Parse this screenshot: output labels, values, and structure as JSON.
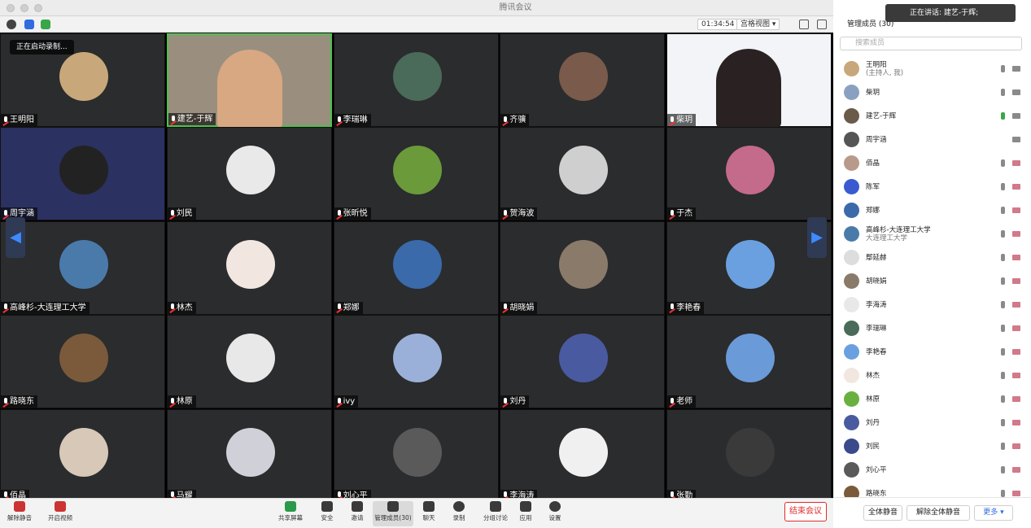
{
  "window": {
    "title": "腾讯会议"
  },
  "top": {
    "timer": "01:34:54",
    "view": "宫格视图 ▾",
    "recording": "正在启动录制..."
  },
  "tiles": [
    {
      "name": "王明阳",
      "bg": "#2b2c2e",
      "av": "#c8a87a"
    },
    {
      "name": "建艺-于辉",
      "bg": "#9a8f7e",
      "av": "",
      "video": true
    },
    {
      "name": "李瑞琳",
      "bg": "#2b2c2e",
      "av": "#4a6a5a"
    },
    {
      "name": "齐骥",
      "bg": "#2b2c2e",
      "av": "#7a5a4a"
    },
    {
      "name": "柴玥",
      "bg": "#f2f4f7",
      "av": "",
      "video": true
    },
    {
      "name": "周宇涵",
      "bg": "#2b3160",
      "av": "#222"
    },
    {
      "name": "刘民",
      "bg": "#2b2c2e",
      "av": "#e9e9e9"
    },
    {
      "name": "张昕悦",
      "bg": "#2b2c2e",
      "av": "#6a9a3a"
    },
    {
      "name": "贺海波",
      "bg": "#2b2c2e",
      "av": "#cfcfcf"
    },
    {
      "name": "于杰",
      "bg": "#2b2c2e",
      "av": "#c46a8a"
    },
    {
      "name": "高峰杉-大连理工大学",
      "bg": "#2b2c2e",
      "av": "#4a7aaa"
    },
    {
      "name": "林杰",
      "bg": "#2b2c2e",
      "av": "#f1e6e0"
    },
    {
      "name": "郑娜",
      "bg": "#2b2c2e",
      "av": "#3a6aaa"
    },
    {
      "name": "胡晓娟",
      "bg": "#2b2c2e",
      "av": "#8a7a6a"
    },
    {
      "name": "李艳春",
      "bg": "#2b2c2e",
      "av": "#6aa0e0"
    },
    {
      "name": "路晓东",
      "bg": "#2b2c2e",
      "av": "#7a5a3a"
    },
    {
      "name": "林原",
      "bg": "#2b2c2e",
      "av": "#e8e8e8"
    },
    {
      "name": "ivy",
      "bg": "#2b2c2e",
      "av": "#9ab0d8"
    },
    {
      "name": "刘丹",
      "bg": "#2b2c2e",
      "av": "#4a5aa0"
    },
    {
      "name": "老师",
      "bg": "#2b2c2e",
      "av": "#6a9ad8"
    },
    {
      "name": "佰晶",
      "bg": "#2b2c2e",
      "av": "#d8c8b8"
    },
    {
      "name": "马耀",
      "bg": "#2b2c2e",
      "av": "#d0d0d8"
    },
    {
      "name": "刘心平",
      "bg": "#2b2c2e",
      "av": "#5a5a5a"
    },
    {
      "name": "李海涛",
      "bg": "#2b2c2e",
      "av": "#f0f0f0"
    },
    {
      "name": "张勤",
      "bg": "#2b2c2e",
      "av": "#3a3a3a"
    }
  ],
  "panel": {
    "title": "管理成员 (30)",
    "speaking": "正在讲话: 建艺-于辉;",
    "search_placeholder": "搜索成员",
    "members": [
      {
        "name": "王明阳",
        "sub": "(主持人, 我)",
        "color": "#c8a87a"
      },
      {
        "name": "柴玥",
        "sub": "",
        "color": "#8aa0c0"
      },
      {
        "name": "建艺-于辉",
        "sub": "",
        "color": "#6a5a4a"
      },
      {
        "name": "周宇涵",
        "sub": "",
        "color": "#555"
      },
      {
        "name": "佰晶",
        "sub": "",
        "color": "#b89a8a"
      },
      {
        "name": "陈军",
        "sub": "",
        "color": "#3a5ad0"
      },
      {
        "name": "郑娜",
        "sub": "",
        "color": "#3a6aaa"
      },
      {
        "name": "高峰杉-大连理工大学",
        "sub": "大连理工大学",
        "color": "#4a7aaa"
      },
      {
        "name": "鄢延赫",
        "sub": "",
        "color": "#ddd"
      },
      {
        "name": "胡晓娟",
        "sub": "",
        "color": "#8a7a6a"
      },
      {
        "name": "李海涛",
        "sub": "",
        "color": "#e8e8e8"
      },
      {
        "name": "李瑞琳",
        "sub": "",
        "color": "#4a6a5a"
      },
      {
        "name": "李艳春",
        "sub": "",
        "color": "#6aa0e0"
      },
      {
        "name": "林杰",
        "sub": "",
        "color": "#f1e6e0"
      },
      {
        "name": "林原",
        "sub": "",
        "color": "#6ab040"
      },
      {
        "name": "刘丹",
        "sub": "",
        "color": "#4a5aa0"
      },
      {
        "name": "刘民",
        "sub": "",
        "color": "#3a4a8a"
      },
      {
        "name": "刘心平",
        "sub": "",
        "color": "#5a5a5a"
      },
      {
        "name": "路晓东",
        "sub": "",
        "color": "#7a5a3a"
      }
    ],
    "mute_all": "全体静音",
    "unmute_all": "解除全体静音",
    "more": "更多 ▾"
  },
  "toolbar": {
    "unmute": "解除静音",
    "video": "开启视频",
    "share": "共享屏幕",
    "security": "安全",
    "invite": "邀请",
    "members": "管理成员(30)",
    "chat": "聊天",
    "record": "录制",
    "breakout": "分组讨论",
    "apps": "应用",
    "settings": "设置",
    "end": "结束会议"
  }
}
